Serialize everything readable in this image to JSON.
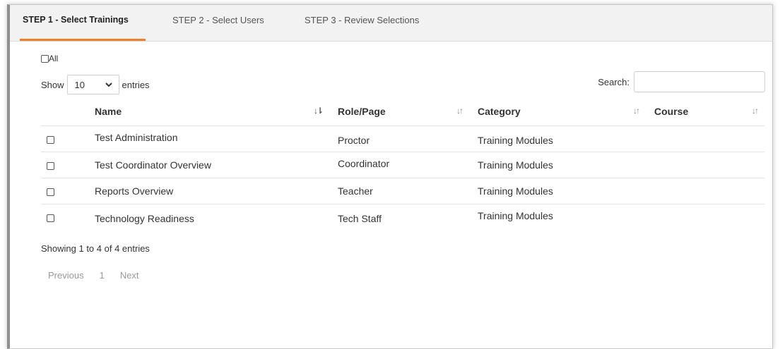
{
  "tabs": [
    {
      "label": "STEP 1 - Select Trainings",
      "active": true
    },
    {
      "label": "STEP 2 - Select Users",
      "active": false
    },
    {
      "label": "STEP 3 - Review Selections",
      "active": false
    }
  ],
  "all_label": "All",
  "show": {
    "prefix": "Show",
    "value": "10",
    "suffix": "entries"
  },
  "search": {
    "label": "Search:",
    "placeholder": ""
  },
  "table": {
    "headers": [
      "Name",
      "Role/Page",
      "Category",
      "Course"
    ],
    "rows": [
      {
        "name": "Test Administration",
        "role": "Proctor",
        "category": "Training Modules",
        "course": ""
      },
      {
        "name": "Test Coordinator Overview",
        "role": "Coordinator",
        "category": "Training Modules",
        "course": ""
      },
      {
        "name": "Reports Overview",
        "role": "Teacher",
        "category": "Training Modules",
        "course": ""
      },
      {
        "name": "Technology Readiness",
        "role": "Tech Staff",
        "category": "Training Modules",
        "course": ""
      }
    ]
  },
  "info": "Showing 1 to 4 of 4 entries",
  "pager": {
    "previous": "Previous",
    "page": "1",
    "next": "Next"
  },
  "colors": {
    "accent": "#f07f2c"
  }
}
